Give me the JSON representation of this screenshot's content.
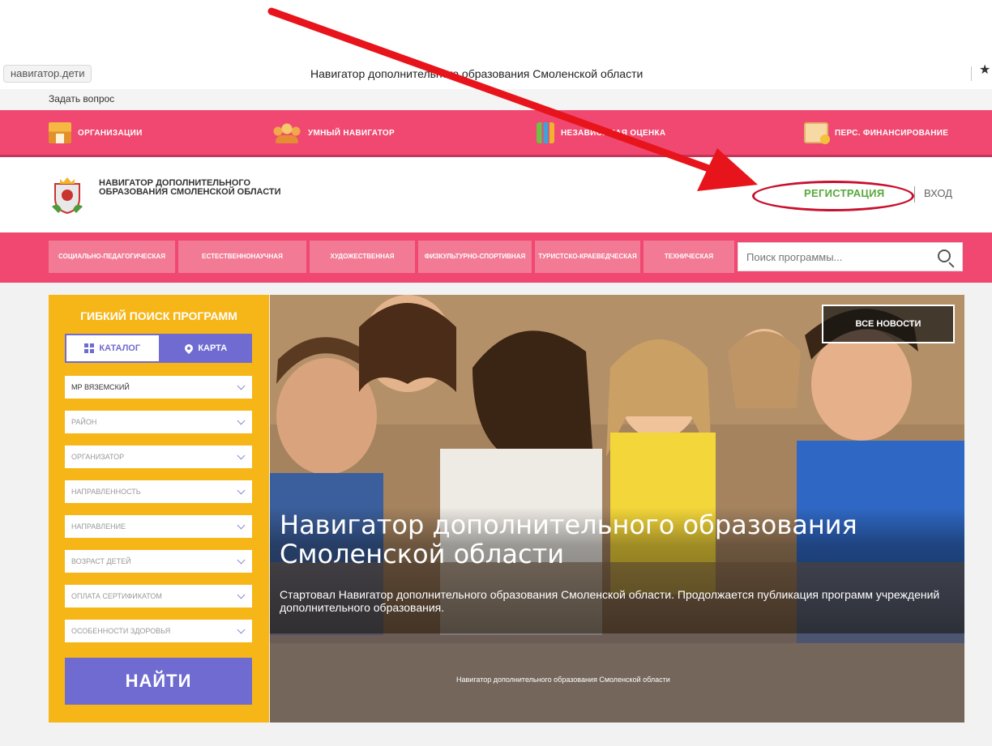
{
  "browser": {
    "url": "навигатор.дети",
    "title": "Навигатор дополнительного образования Смоленской области"
  },
  "ask_question": "Задать вопрос",
  "top_nav": [
    {
      "label": "ОРГАНИЗАЦИИ",
      "icon": "building-icon"
    },
    {
      "label": "УМНЫЙ НАВИГАТОР",
      "icon": "people-icon"
    },
    {
      "label": "НЕЗАВИСИМАЯ ОЦЕНКА",
      "icon": "chart-icon"
    },
    {
      "label": "ПЕРС. ФИНАНСИРОВАНИЕ",
      "icon": "money-icon"
    }
  ],
  "header": {
    "logo_text": "НАВИГАТОР ДОПОЛНИТЕЛЬНОГО ОБРАЗОВАНИЯ СМОЛЕНСКОЙ ОБЛАСТИ",
    "register_label": "РЕГИСТРАЦИЯ",
    "login_label": "ВХОД"
  },
  "categories": [
    "СОЦИАЛЬНО-ПЕДАГОГИЧЕСКАЯ",
    "ЕСТЕСТВЕННОНАУЧНАЯ",
    "ХУДОЖЕСТВЕННАЯ",
    "ФИЗКУЛЬТУРНО-СПОРТИВНАЯ",
    "ТУРИСТСКО-КРАЕВЕДЧЕСКАЯ",
    "ТЕХНИЧЕСКАЯ"
  ],
  "search": {
    "placeholder": "Поиск программы..."
  },
  "sidebar": {
    "title": "ГИБКИЙ ПОИСК ПРОГРАММ",
    "tab_catalog": "КАТАЛОГ",
    "tab_map": "КАРТА",
    "filters": [
      "МР ВЯЗЕМСКИЙ",
      "РАЙОН",
      "ОРГАНИЗАТОР",
      "НАПРАВЛЕННОСТЬ",
      "НАПРАВЛЕНИЕ",
      "ВОЗРАСТ ДЕТЕЙ",
      "ОПЛАТА СЕРТИФИКАТОМ",
      "ОСОБЕННОСТИ ЗДОРОВЬЯ"
    ],
    "find_label": "НАЙТИ"
  },
  "hero": {
    "news_label": "ВСЕ НОВОСТИ",
    "title": "Навигатор дополнительного образования Смоленской области",
    "description": "Стартовал Навигатор дополнительного образования Смоленской области. Продолжается публикация программ учреждений дополнительного образования.",
    "caption": "Навигатор дополнительного образования Смоленской области"
  },
  "colors": {
    "accent_pink": "#f04870",
    "sidebar_yellow": "#f7b618",
    "purple": "#6f6bd0",
    "register_green": "#59a93b",
    "annotation_red": "#e8141c"
  }
}
